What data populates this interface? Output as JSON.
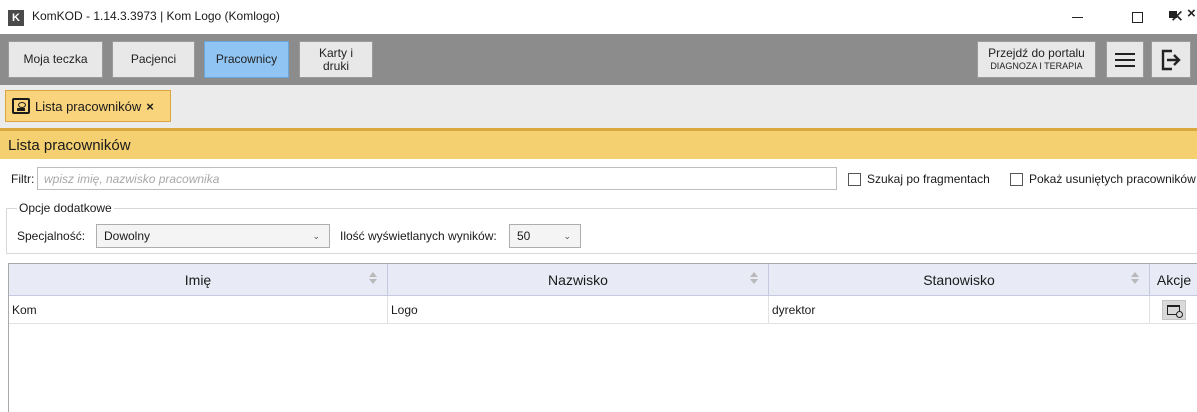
{
  "window": {
    "logo_letter": "K",
    "title": "KomKOD - 1.14.3.3973 | Kom Logo (Komlogo)",
    "close_glyph": "✕"
  },
  "toolbar": {
    "moja_teczka": "Moja teczka",
    "pacjenci": "Pacjenci",
    "pracownicy": "Pracownicy",
    "karty_line1": "Karty i",
    "karty_line2": "druki",
    "portal_line1": "Przejdź do portalu",
    "portal_line2": "DIAGNOZA I TERAPIA",
    "active_color": "#90c4f2"
  },
  "tabs": [
    {
      "label": "Lista pracowników",
      "close": "×",
      "color": "#f9d47c"
    }
  ],
  "panel": {
    "title": "Lista pracowników",
    "close": "×"
  },
  "filter": {
    "label": "Filtr:",
    "placeholder": "wpisz imię, nazwisko pracownika",
    "value": "",
    "fragments_label": "Szukaj po fragmentach",
    "fragments_checked": false,
    "deleted_label": "Pokaż usuniętych pracowników",
    "deleted_checked": false
  },
  "options": {
    "legend": "Opcje dodatkowe",
    "specialty_label": "Specjalność:",
    "specialty_value": "Dowolny",
    "count_label": "Ilość wyświetlanych wyników:",
    "count_value": "50"
  },
  "table": {
    "headers": [
      "Imię",
      "Nazwisko",
      "Stanowisko",
      "Akcje"
    ],
    "rows": [
      {
        "imie": "Kom",
        "nazwisko": "Logo",
        "stanowisko": "dyrektor",
        "action_icon": "folder-search-icon"
      }
    ]
  }
}
